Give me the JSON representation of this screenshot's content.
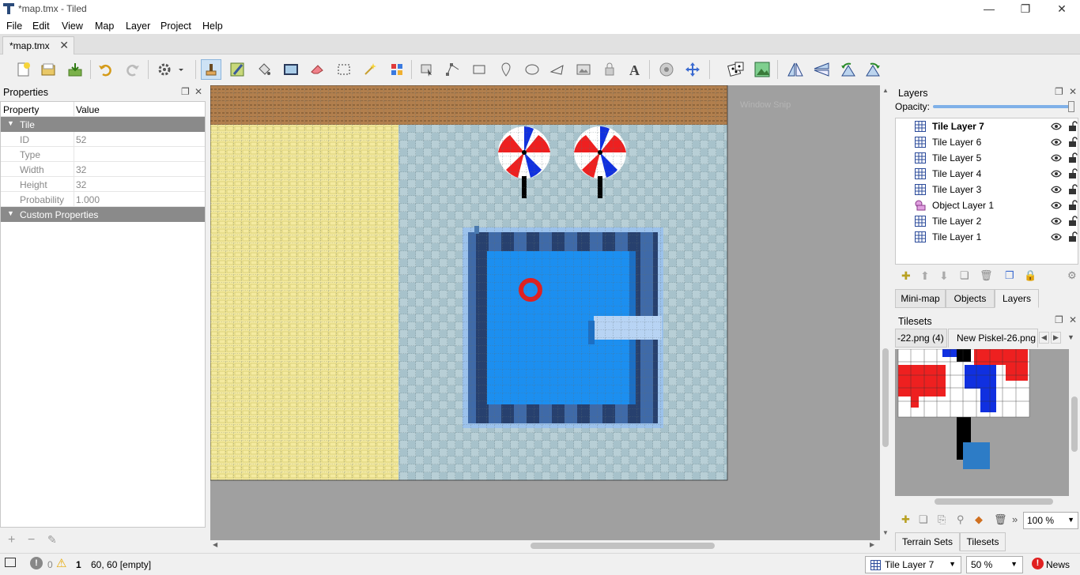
{
  "window": {
    "title": "*map.tmx - Tiled",
    "minimize": "—",
    "maximize": "❐",
    "close": "✕"
  },
  "menu": [
    "File",
    "Edit",
    "View",
    "Map",
    "Layer",
    "Project",
    "Help"
  ],
  "doc_tab": {
    "label": "*map.tmx",
    "close": "✕"
  },
  "toolbar_icons": [
    "new-map-icon",
    "open-icon",
    "save-icon",
    "undo-icon",
    "redo-icon",
    "commands-icon",
    "stamp-brush-icon",
    "terrain-brush-icon",
    "bucket-fill-icon",
    "shape-fill-icon",
    "eraser-icon",
    "rect-select-icon",
    "magic-wand-icon",
    "select-same-tile-icon",
    "select-objects-icon",
    "edit-polygons-icon",
    "insert-rectangle-icon",
    "insert-point-icon",
    "insert-ellipse-icon",
    "insert-polygon-icon",
    "insert-tile-icon",
    "insert-template-icon",
    "insert-text-icon",
    "random-mode-icon",
    "wang-fill-icon",
    "dice-icon",
    "auto-map-icon",
    "flip-horizontal-icon",
    "flip-vertical-icon",
    "rotate-left-icon",
    "rotate-right-icon"
  ],
  "properties": {
    "title": "Properties",
    "col_property": "Property",
    "col_value": "Value",
    "group_tile": "Tile",
    "rows": [
      {
        "k": "ID",
        "v": "52"
      },
      {
        "k": "Type",
        "v": ""
      },
      {
        "k": "Width",
        "v": "32"
      },
      {
        "k": "Height",
        "v": "32"
      },
      {
        "k": "Probability",
        "v": "1.000"
      }
    ],
    "group_custom": "Custom Properties",
    "foot": [
      "+",
      "−",
      "✎"
    ]
  },
  "map": {
    "overlay_text": "Window Snip"
  },
  "layers": {
    "title": "Layers",
    "opacity_label": "Opacity:",
    "opacity": 1.0,
    "items": [
      {
        "name": "Tile Layer 7",
        "type": "tile",
        "bold": true
      },
      {
        "name": "Tile Layer 6",
        "type": "tile"
      },
      {
        "name": "Tile Layer 5",
        "type": "tile"
      },
      {
        "name": "Tile Layer 4",
        "type": "tile"
      },
      {
        "name": "Tile Layer 3",
        "type": "tile"
      },
      {
        "name": "Object Layer 1",
        "type": "object"
      },
      {
        "name": "Tile Layer 2",
        "type": "tile"
      },
      {
        "name": "Tile Layer 1",
        "type": "tile"
      }
    ],
    "tabs": [
      "Mini-map",
      "Objects",
      "Layers"
    ]
  },
  "tilesets": {
    "title": "Tilesets",
    "tabs": [
      "-22.png (4)",
      "New Piskel-26.png"
    ],
    "zoom": "100 %",
    "more": "»",
    "bottom_tabs": [
      "Terrain Sets",
      "Tilesets"
    ]
  },
  "status": {
    "errors": "0",
    "warnings": "1",
    "coords": "60, 60 [empty]",
    "layer": "Tile Layer 7",
    "zoom": "50 %",
    "news": "News"
  }
}
